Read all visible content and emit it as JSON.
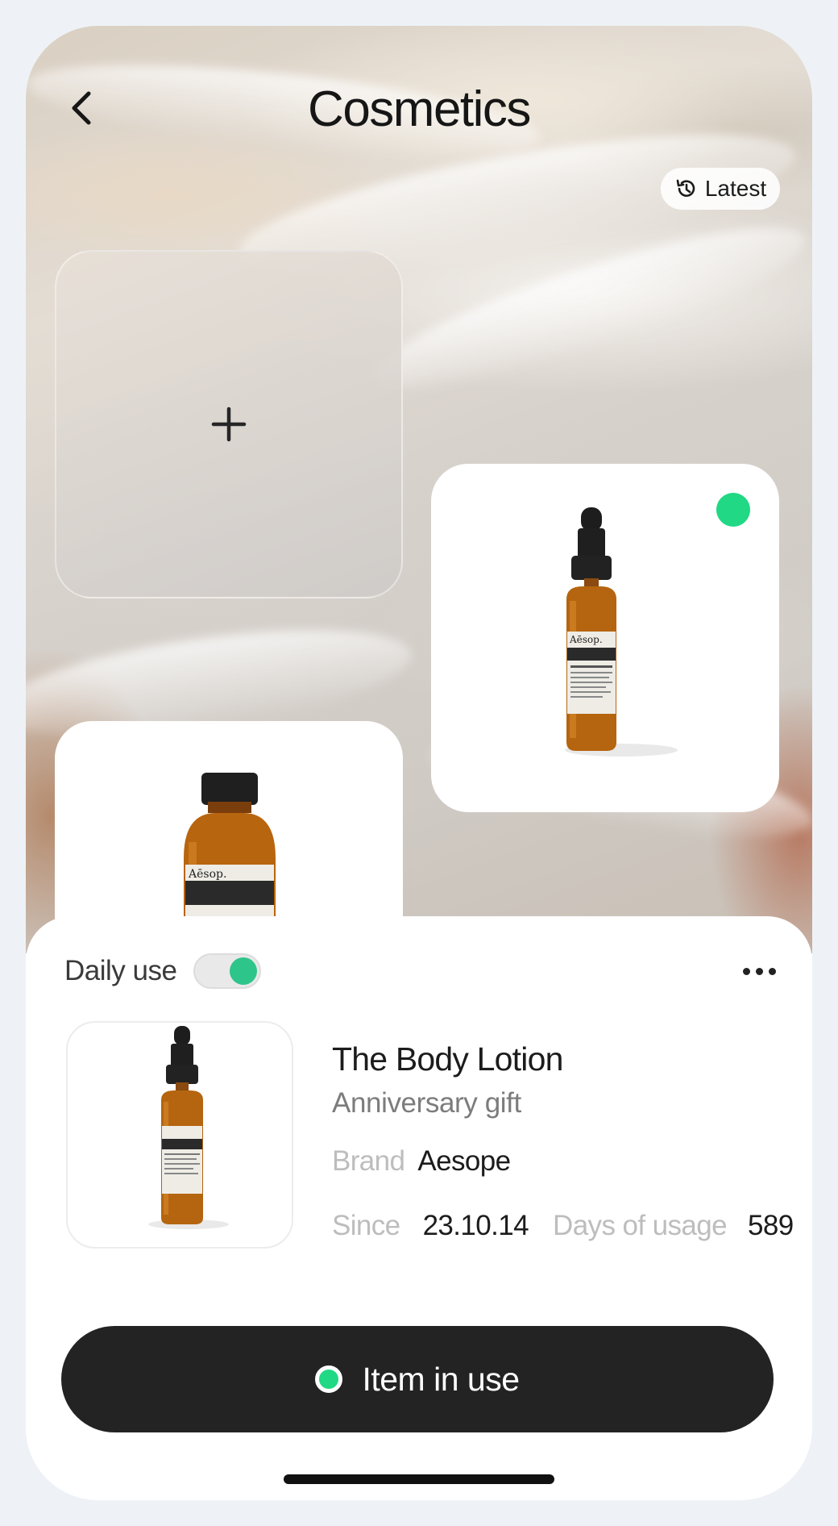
{
  "header": {
    "title": "Cosmetics",
    "sort_chip_label": "Latest"
  },
  "collection": {
    "add_card_label": "+",
    "items": [
      {
        "brand_on_label": "Aēsop.",
        "product_label": "Lucent Facial Concentrate",
        "in_use": true
      },
      {
        "brand_on_label": "Aēsop.",
        "product_label": "Amazing Face Cleanser",
        "in_use": false
      }
    ]
  },
  "detail": {
    "daily_use_label": "Daily use",
    "daily_use_on": true,
    "item_title": "The Body Lotion",
    "item_subtitle": "Anniversary gift",
    "brand_label": "Brand",
    "brand_value": "Aesope",
    "since_label": "Since",
    "since_value": "23.10.14",
    "days_label": "Days of usage",
    "days_value": "589"
  },
  "primary_action": {
    "label": "Item in use"
  },
  "colors": {
    "accent_green": "#21d884",
    "button_dark": "#232323",
    "toggle_green": "#2ec58a"
  }
}
